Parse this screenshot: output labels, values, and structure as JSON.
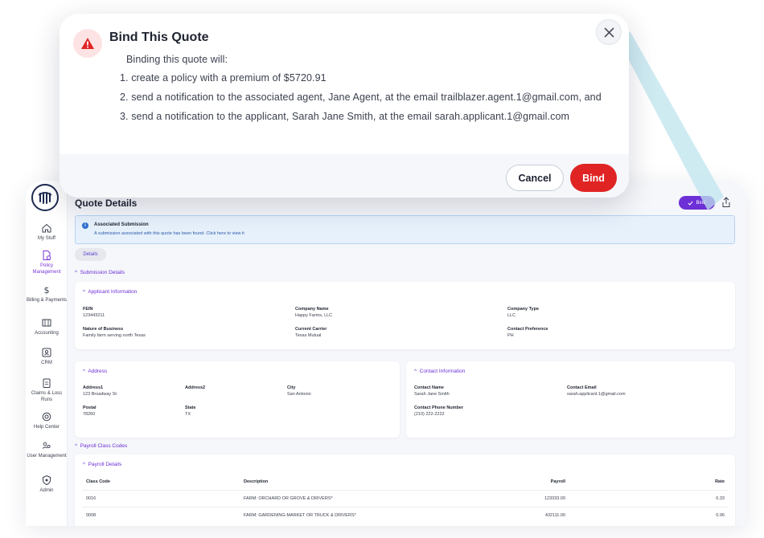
{
  "modal": {
    "title": "Bind This Quote",
    "intro": "Binding this quote will:",
    "items": [
      "1. create a policy with a premium of $5720.91",
      "2. send a notification to the associated agent, Jane Agent, at the email trailblazer.agent.1@gmail.com, and",
      "3. send a notification to the applicant, Sarah Jane Smith, at the email sarah.applicant.1@gmail.com"
    ],
    "cancel_label": "Cancel",
    "bind_label": "Bind",
    "icons": {
      "warning": "warning-triangle-icon",
      "close": "close-icon"
    },
    "colors": {
      "bind": "#e02424",
      "warning_bg": "#fde3e3"
    }
  },
  "sidebar": {
    "items": [
      {
        "label": "My Stuff",
        "icon": "home-icon"
      },
      {
        "label": "Policy Management",
        "icon": "document-gear-icon",
        "active": true
      },
      {
        "label": "Billing & Payments",
        "icon": "dollar-icon"
      },
      {
        "label": "Accounting",
        "icon": "ledger-icon"
      },
      {
        "label": "CRM",
        "icon": "contact-card-icon"
      },
      {
        "label": "Claims & Loss Runs",
        "icon": "clipboard-icon"
      },
      {
        "label": "Help Center",
        "icon": "lifebuoy-icon"
      },
      {
        "label": "User Management",
        "icon": "users-icon"
      },
      {
        "label": "Admin",
        "icon": "shield-gear-icon"
      }
    ]
  },
  "header": {
    "title": "Quote Details",
    "bind_label": "Bind",
    "accent": "#6d2fd6"
  },
  "banner": {
    "title": "Associated Submission",
    "text": "A submission associated with this quote has been found. Click here to view it"
  },
  "tabs": {
    "details": "Details"
  },
  "sections": {
    "submission_details": "Submission Details",
    "payroll_class_codes": "Payroll Class Codes"
  },
  "applicant": {
    "heading": "Applicant Information",
    "fein_label": "FEIN",
    "fein": "123443211",
    "company_name_label": "Company Name",
    "company_name": "Happy Farms, LLC",
    "company_type_label": "Company Type",
    "company_type": "LLC",
    "nature_label": "Nature of Business",
    "nature": "Family farm serving north Texas",
    "carrier_label": "Current Carrier",
    "carrier": "Texas Mutual",
    "contact_pref_label": "Contact Preference",
    "contact_pref": "PH"
  },
  "address": {
    "heading": "Address",
    "address1_label": "Address1",
    "address1": "123 Broadway St",
    "address2_label": "Address2",
    "address2": "",
    "city_label": "City",
    "city": "San Antonio",
    "postal_label": "Postal",
    "postal": "78260",
    "state_label": "State",
    "state": "TX"
  },
  "contact": {
    "heading": "Contact Information",
    "name_label": "Contact Name",
    "name": "Sarah Jane Smith",
    "email_label": "Contact Email",
    "email": "sarah.applicant.1@gmail.com",
    "phone_label": "Contact Phone Number",
    "phone": "(210) 222-2222"
  },
  "payroll": {
    "heading": "Payroll Details",
    "columns": [
      "Class Code",
      "Description",
      "Payroll",
      "Rate"
    ],
    "rows": [
      {
        "code": "0016",
        "description": "FARM: ORCHARD OR GROVE & DRIVERS*",
        "payroll": "123333.00",
        "rate": "0.33"
      },
      {
        "code": "0008",
        "description": "FARM: GARDENING-MARKET OR TRUCK & DRIVERS*",
        "payroll": "432111.00",
        "rate": "0.96"
      }
    ]
  }
}
